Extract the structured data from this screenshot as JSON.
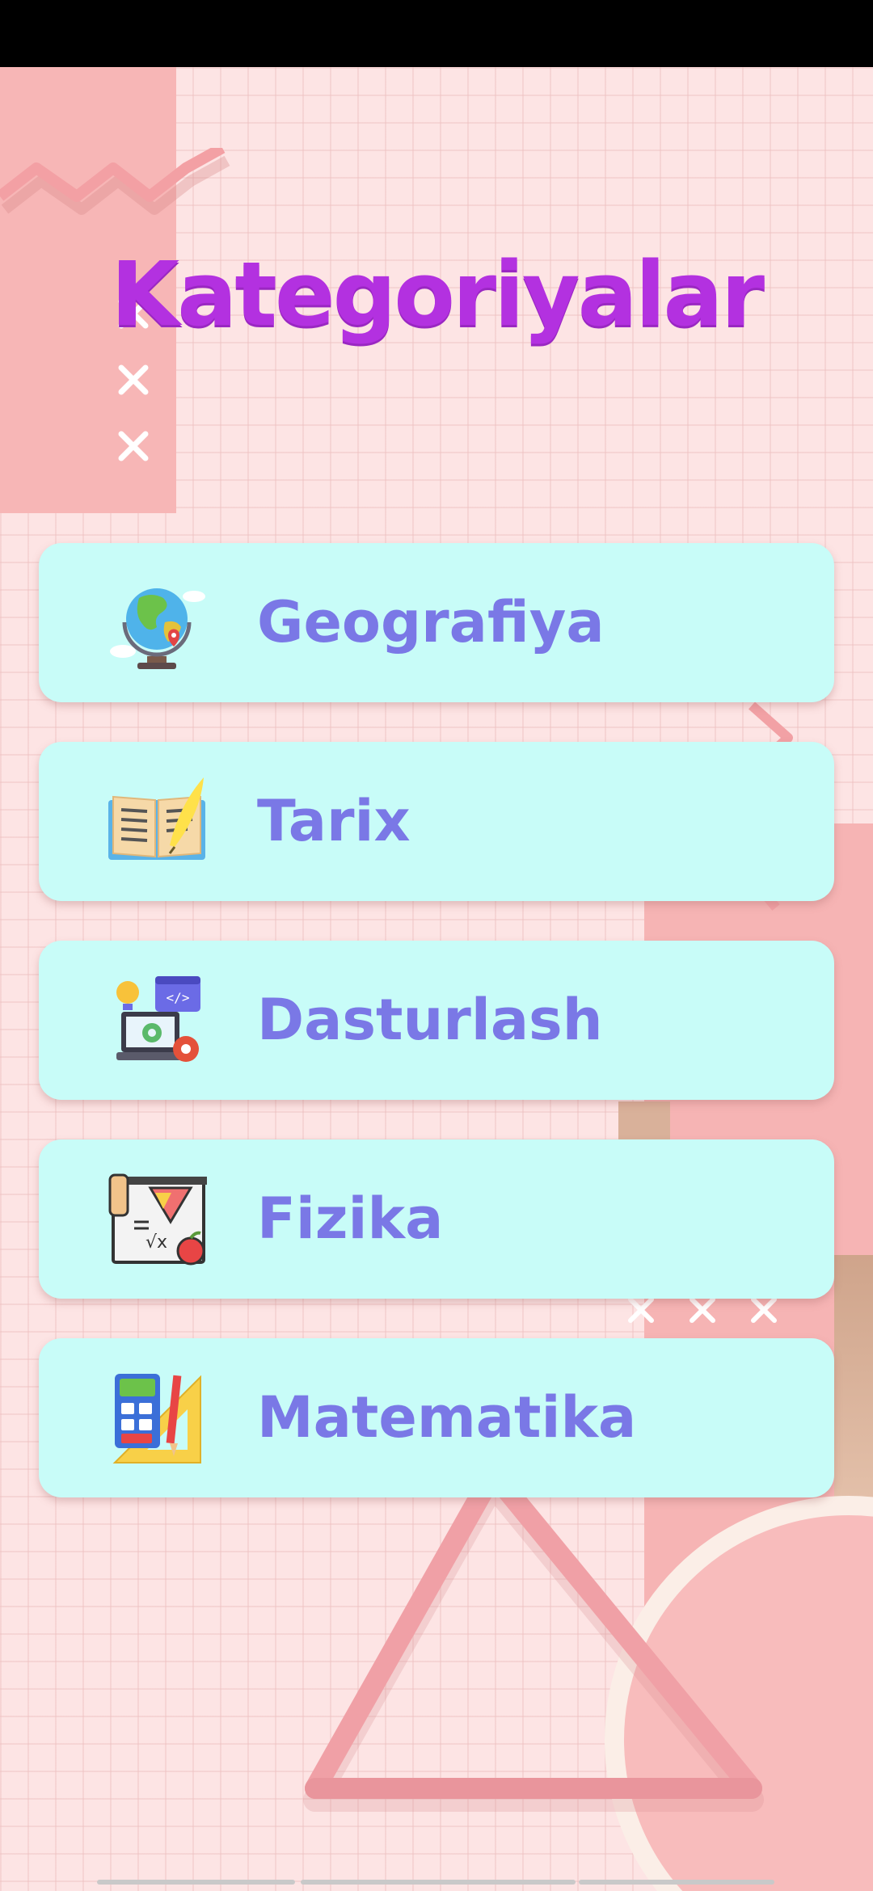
{
  "screen": {
    "title": "Kategoriyalar"
  },
  "categories": [
    {
      "label": "Geografiya",
      "icon": "globe-icon"
    },
    {
      "label": "Tarix",
      "icon": "open-book-icon"
    },
    {
      "label": "Dasturlash",
      "icon": "programming-laptop-icon"
    },
    {
      "label": "Fizika",
      "icon": "physics-board-icon"
    },
    {
      "label": "Matematika",
      "icon": "calculator-ruler-icon"
    }
  ],
  "colors": {
    "background": "#fde4e4",
    "title": "#b331e0",
    "card": "#c8fcf8",
    "card_text": "#7a78e6"
  }
}
